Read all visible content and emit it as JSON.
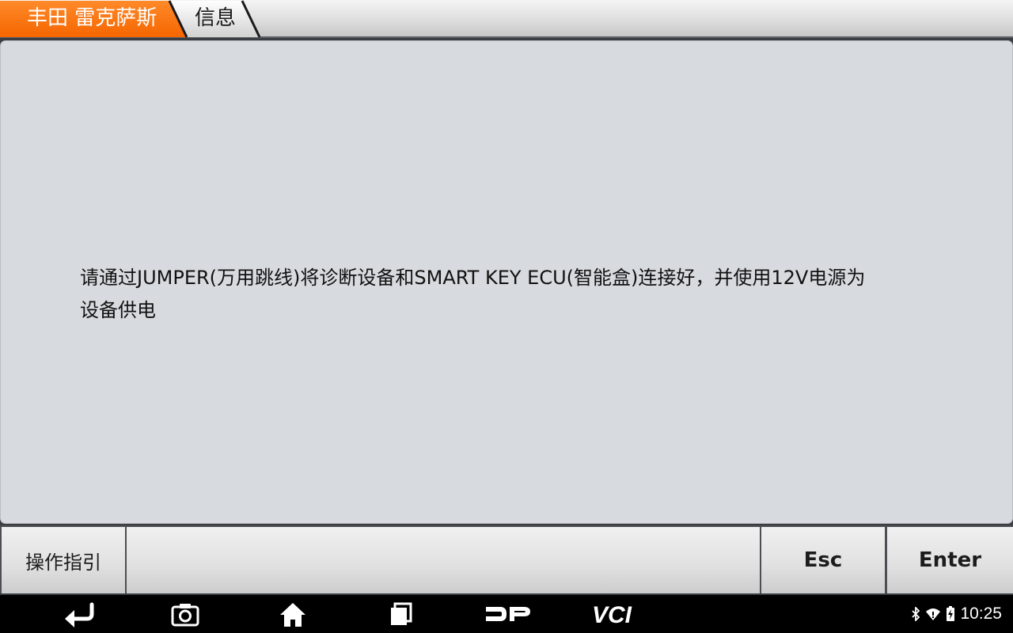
{
  "breadcrumb": {
    "items": [
      {
        "label": "丰田 雷克萨斯"
      },
      {
        "label": "信息"
      }
    ],
    "active_color": "#ff6a00"
  },
  "message": {
    "line1": "请通过JUMPER(万用跳线)将诊断设备和SMART KEY ECU(智能盒)连接好，并使用12V电源为",
    "line2": "设备供电"
  },
  "buttons": {
    "guide_label": "操作指引",
    "esc_label": "Esc",
    "enter_label": "Enter"
  },
  "navbar": {
    "icons": [
      "back-icon",
      "camera-icon",
      "home-icon",
      "recent-apps-icon",
      "dp-logo-icon",
      "vci-logo-icon"
    ],
    "status_icons": [
      "bluetooth-icon",
      "wifi-icon",
      "battery-charging-icon"
    ],
    "clock": "10:25"
  }
}
